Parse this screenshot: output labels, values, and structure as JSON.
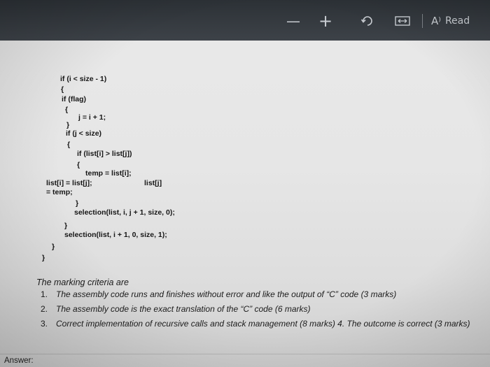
{
  "toolbar": {
    "zoom_out_glyph": "—",
    "zoom_in_glyph": "+",
    "read_aloud_icon": "A⁾",
    "read_aloud_label": "Read"
  },
  "code_lines": [
    "if (i < size - 1)",
    "{",
    "if (flag)",
    "{",
    "j = i + 1;",
    "}",
    "if (j < size)",
    "{",
    "if (list[i] > list[j])",
    "{",
    "temp = list[i];",
    "list[i] = list[j];",
    "list[j]",
    "= temp;",
    "}",
    "selection(list, i, j + 1, size, 0);",
    "}",
    "selection(list, i + 1, 0, size, 1);",
    "}",
    "}"
  ],
  "criteria": {
    "title": "The marking criteria are",
    "items": [
      {
        "num": "1.",
        "text": "The assembly code runs and finishes without error and like the output of “C” code (3 marks)"
      },
      {
        "num": "2.",
        "text": "The assembly code is the exact translation of the “C” code (6 marks)"
      },
      {
        "num": "3.",
        "text": "Correct implementation of recursive calls and stack management (8 marks) 4. The outcome is correct (3 marks)"
      }
    ]
  },
  "answer_label": "Answer:"
}
